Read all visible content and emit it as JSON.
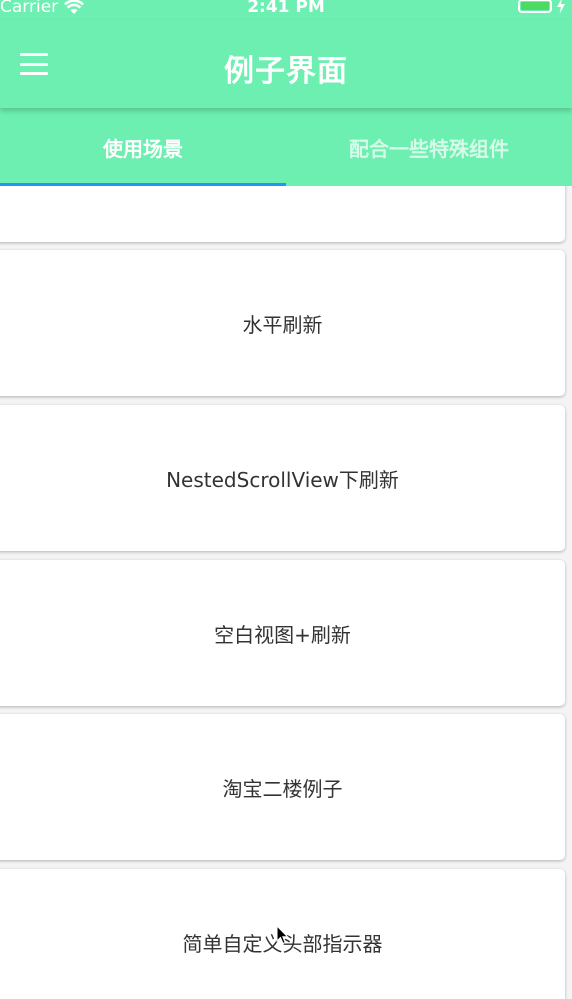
{
  "status_bar": {
    "carrier": "Carrier",
    "time": "2:41 PM"
  },
  "app_bar": {
    "title": "例子界面"
  },
  "tabs": [
    {
      "label": "使用场景",
      "active": true
    },
    {
      "label": "配合一些特殊组件",
      "active": false
    }
  ],
  "list": {
    "items": [
      {
        "label": ""
      },
      {
        "label": "水平刷新"
      },
      {
        "label": "NestedScrollView下刷新"
      },
      {
        "label": "空白视图+刷新"
      },
      {
        "label": "淘宝二楼例子"
      },
      {
        "label": "简单自定义头部指示器"
      }
    ]
  },
  "colors": {
    "app_bar": "#6cefb1",
    "tab_indicator": "#2196f3",
    "battery": "#4cd964",
    "card_text": "#333333"
  }
}
